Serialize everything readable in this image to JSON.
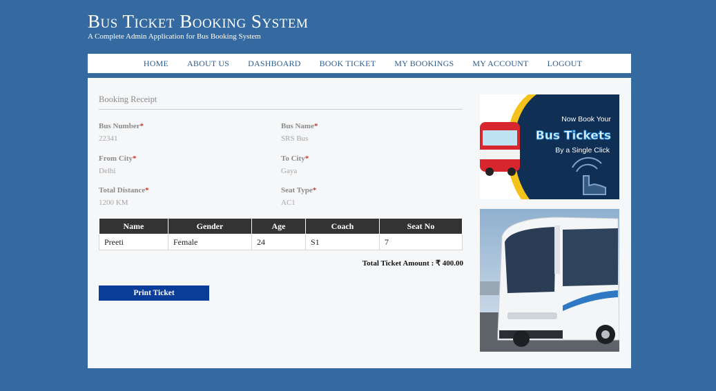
{
  "header": {
    "title": "Bus Ticket Booking System",
    "subtitle": "A Complete Admin Application for Bus Booking System"
  },
  "nav": {
    "items": [
      "HOME",
      "ABOUT US",
      "DASHBOARD",
      "BOOK TICKET",
      "MY BOOKINGS",
      "MY ACCOUNT",
      "LOGOUT"
    ]
  },
  "receipt": {
    "title": "Booking Receipt",
    "bus_number_label": "Bus Number",
    "bus_number": "22341",
    "bus_name_label": "Bus Name",
    "bus_name": "SRS Bus",
    "from_city_label": "From City",
    "from_city": "Delhi",
    "to_city_label": "To City",
    "to_city": "Gaya",
    "distance_label": "Total Distance",
    "distance": "1200 KM",
    "seat_type_label": "Seat Type",
    "seat_type": "AC1",
    "required_mark": "*"
  },
  "table": {
    "headers": [
      "Name",
      "Gender",
      "Age",
      "Coach",
      "Seat No"
    ],
    "rows": [
      [
        "Preeti",
        "Female",
        "24",
        "S1",
        "7"
      ]
    ]
  },
  "total": "Total Ticket Amount : ₹ 400.00",
  "print_button": "Print Ticket",
  "ad": {
    "line1": "Now Book Your",
    "line2": "Bus Tickets",
    "line3": "By a Single Click"
  },
  "colors": {
    "background": "#346a9f",
    "button": "#0a3d99",
    "table_header": "#333333",
    "ad_bg": "#0f2f55",
    "ad_yellow": "#f5c21b"
  }
}
